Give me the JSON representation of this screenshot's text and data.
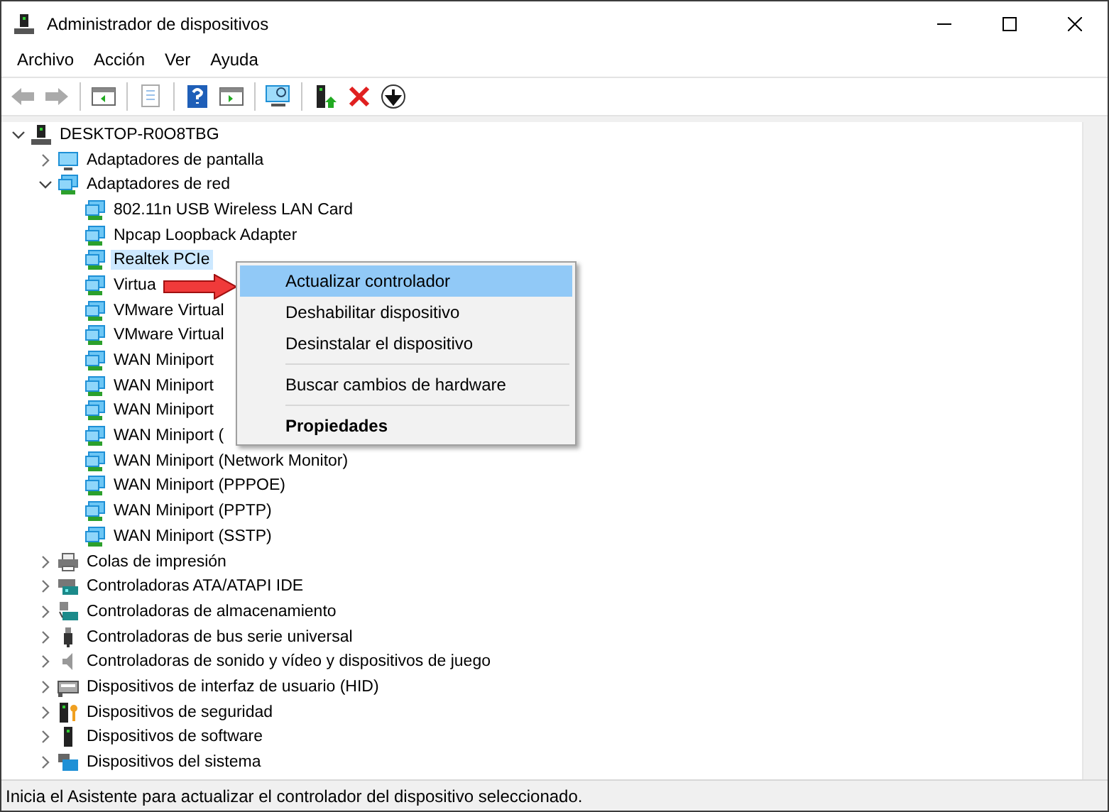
{
  "window": {
    "title": "Administrador de dispositivos"
  },
  "menu": [
    {
      "label": "Archivo"
    },
    {
      "label": "Acción"
    },
    {
      "label": "Ver"
    },
    {
      "label": "Ayuda"
    }
  ],
  "toolbar": [
    {
      "kind": "back",
      "disabled": true
    },
    {
      "kind": "forward",
      "disabled": true
    },
    {
      "kind": "sep"
    },
    {
      "kind": "tree",
      "disabled": false
    },
    {
      "kind": "sep"
    },
    {
      "kind": "properties",
      "disabled": true
    },
    {
      "kind": "sep"
    },
    {
      "kind": "help",
      "disabled": false
    },
    {
      "kind": "pane",
      "disabled": false
    },
    {
      "kind": "sep"
    },
    {
      "kind": "scan",
      "disabled": false
    },
    {
      "kind": "sep"
    },
    {
      "kind": "update",
      "disabled": false
    },
    {
      "kind": "remove",
      "disabled": false
    },
    {
      "kind": "download",
      "disabled": false
    }
  ],
  "tree": {
    "label": "DESKTOP-R0O8TBG",
    "kind": "computer",
    "expanded": true,
    "selected": false,
    "children": [
      {
        "label": "Adaptadores de pantalla",
        "kind": "display",
        "expanded": false,
        "selected": false
      },
      {
        "label": "Adaptadores de red",
        "kind": "network",
        "expanded": true,
        "selected": false,
        "children": [
          {
            "label": "802.11n USB Wireless LAN Card",
            "kind": "network",
            "selected": false
          },
          {
            "label": "Npcap Loopback Adapter",
            "kind": "network",
            "selected": false
          },
          {
            "label": "Realtek PCIe",
            "kind": "network",
            "selected": true
          },
          {
            "label": "Virtua",
            "kind": "network",
            "selected": false
          },
          {
            "label": "VMware Virtual",
            "kind": "network",
            "selected": false
          },
          {
            "label": "VMware Virtual",
            "kind": "network",
            "selected": false
          },
          {
            "label": "WAN Miniport",
            "kind": "network",
            "selected": false
          },
          {
            "label": "WAN Miniport",
            "kind": "network",
            "selected": false
          },
          {
            "label": "WAN Miniport",
            "kind": "network",
            "selected": false
          },
          {
            "label": "WAN Miniport (",
            "kind": "network",
            "selected": false
          },
          {
            "label": "WAN Miniport (Network Monitor)",
            "kind": "network",
            "selected": false
          },
          {
            "label": "WAN Miniport (PPPOE)",
            "kind": "network",
            "selected": false
          },
          {
            "label": "WAN Miniport (PPTP)",
            "kind": "network",
            "selected": false
          },
          {
            "label": "WAN Miniport (SSTP)",
            "kind": "network",
            "selected": false
          }
        ]
      },
      {
        "label": "Colas de impresión",
        "kind": "printer",
        "expanded": false,
        "selected": false
      },
      {
        "label": "Controladoras ATA/ATAPI IDE",
        "kind": "disk",
        "expanded": false,
        "selected": false
      },
      {
        "label": "Controladoras de almacenamiento",
        "kind": "storage",
        "expanded": false,
        "selected": false
      },
      {
        "label": "Controladoras de bus serie universal",
        "kind": "usb",
        "expanded": false,
        "selected": false
      },
      {
        "label": "Controladoras de sonido y vídeo y dispositivos de juego",
        "kind": "sound",
        "expanded": false,
        "selected": false
      },
      {
        "label": "Dispositivos de interfaz de usuario (HID)",
        "kind": "hid",
        "expanded": false,
        "selected": false
      },
      {
        "label": "Dispositivos de seguridad",
        "kind": "security",
        "expanded": false,
        "selected": false
      },
      {
        "label": "Dispositivos de software",
        "kind": "software",
        "expanded": false,
        "selected": false
      },
      {
        "label": "Dispositivos del sistema",
        "kind": "system",
        "expanded": false,
        "selected": false
      }
    ]
  },
  "context_menu": [
    {
      "kind": "item",
      "label": "Actualizar controlador",
      "selected": true,
      "default": false
    },
    {
      "kind": "item",
      "label": "Deshabilitar dispositivo",
      "selected": false,
      "default": false
    },
    {
      "kind": "item",
      "label": "Desinstalar el dispositivo",
      "selected": false,
      "default": false
    },
    {
      "kind": "separator"
    },
    {
      "kind": "item",
      "label": "Buscar cambios de hardware",
      "selected": false,
      "default": false
    },
    {
      "kind": "separator"
    },
    {
      "kind": "item",
      "label": "Propiedades",
      "selected": false,
      "default": true
    }
  ],
  "status_bar": {
    "text": "Inicia el Asistente para actualizar el controlador del dispositivo seleccionado."
  }
}
